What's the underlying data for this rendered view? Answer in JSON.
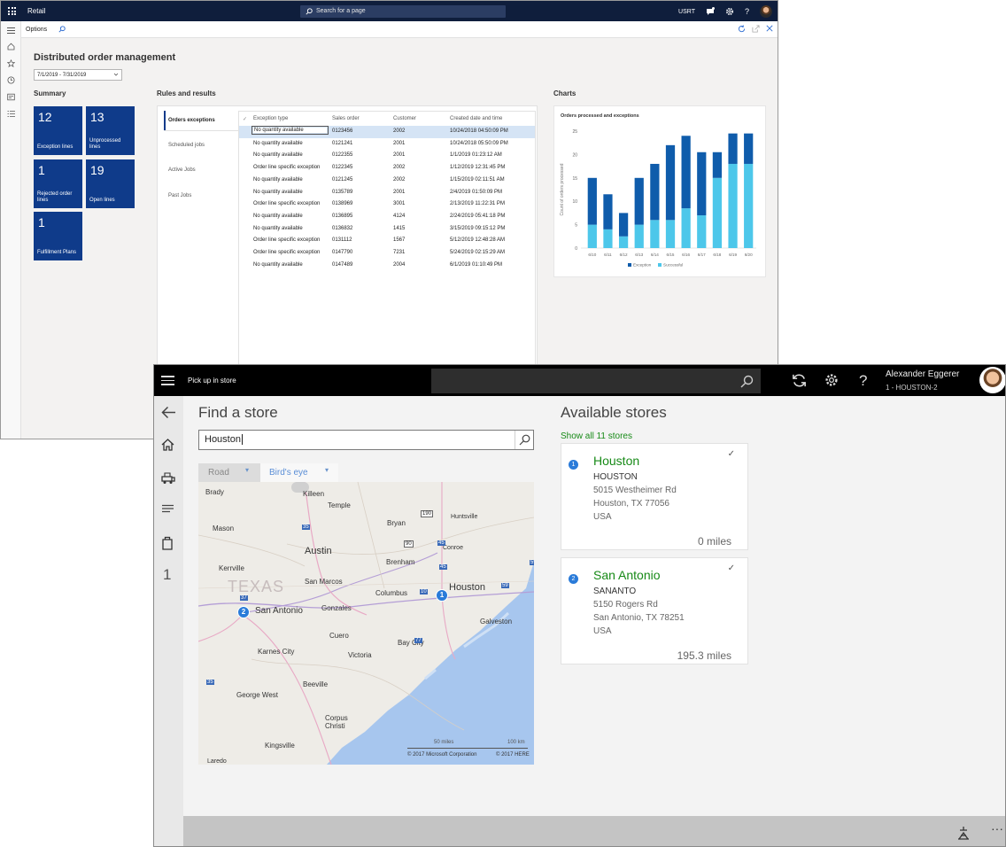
{
  "window1": {
    "app_name": "Retail",
    "search_placeholder": "Search for a page",
    "user_code": "USRT",
    "actionbar": {
      "options_label": "Options"
    },
    "page_title": "Distributed order management",
    "date_range": "7/1/2019 - 7/31/2019",
    "summary": {
      "heading": "Summary",
      "tiles": [
        {
          "value": "12",
          "label": "Exception lines"
        },
        {
          "value": "13",
          "label": "Unprocessed lines"
        },
        {
          "value": "1",
          "label": "Rejected order lines"
        },
        {
          "value": "19",
          "label": "Open lines"
        },
        {
          "value": "1",
          "label": "Fulfillment Plans"
        }
      ]
    },
    "rules": {
      "heading": "Rules and results",
      "tabs": [
        "Orders exceptions",
        "Scheduled jobs",
        "Active Jobs",
        "Past Jobs"
      ],
      "columns": [
        "Exception type",
        "Sales order",
        "Customer",
        "Created date and time"
      ],
      "rows": [
        [
          "No quantity available",
          "0123456",
          "2002",
          "10/24/2018 04:50:09 PM"
        ],
        [
          "No quantity available",
          "0121241",
          "2001",
          "10/24/2018 05:50:09 PM"
        ],
        [
          "No quantity available",
          "0122355",
          "2001",
          "1/1/2019 01:23:12 AM"
        ],
        [
          "Order line specific exception",
          "0122345",
          "2002",
          "1/12/2019 12:31:45 PM"
        ],
        [
          "No quantity available",
          "0121245",
          "2002",
          "1/15/2019 02:11:51 AM"
        ],
        [
          "No quantity available",
          "0135789",
          "2001",
          "2/4/2019 01:50:09 PM"
        ],
        [
          "Order line specific exception",
          "0138969",
          "3001",
          "2/13/2019 11:22:31 PM"
        ],
        [
          "No quantity available",
          "0136895",
          "4124",
          "2/24/2019 05:41:18 PM"
        ],
        [
          "No quantity available",
          "0136832",
          "1415",
          "3/15/2019 09:15:12 PM"
        ],
        [
          "Order line specific exception",
          "0131112",
          "1567",
          "5/12/2019 12:48:28 AM"
        ],
        [
          "Order line specific exception",
          "0147790",
          "7231",
          "5/24/2019 02:15:29 AM"
        ],
        [
          "No quantity available",
          "0147489",
          "2004",
          "6/1/2019 01:10:49 PM"
        ]
      ]
    },
    "charts": {
      "heading": "Charts"
    }
  },
  "chart_data": {
    "type": "bar",
    "stacked": true,
    "title": "Orders processed and exceptions",
    "ylabel": "Count of orders processed",
    "xlabel": "",
    "categories": [
      "6/10",
      "6/11",
      "6/12",
      "6/13",
      "6/14",
      "6/15",
      "6/16",
      "6/17",
      "6/18",
      "6/19",
      "6/20"
    ],
    "series": [
      {
        "name": "Successful",
        "color": "#4dc7ea",
        "values": [
          5,
          4,
          2.5,
          5,
          6,
          6,
          8.5,
          7,
          15,
          18,
          18
        ]
      },
      {
        "name": "Exception",
        "color": "#0f5cab",
        "values": [
          10,
          7.5,
          5,
          10,
          12,
          16,
          15.5,
          13.5,
          5.5,
          6.5,
          6.5
        ]
      }
    ],
    "ylim": [
      0,
      25
    ],
    "yticks": [
      0,
      5,
      10,
      15,
      20,
      25
    ],
    "legend": "bottom",
    "grid": false
  },
  "window2": {
    "title": "Pick up in store",
    "user_name": "Alexander Eggerer",
    "store_label": "1 - HOUSTON-2",
    "rail_number": "1",
    "find_heading": "Find a store",
    "search_value": "Houston",
    "map": {
      "road_label": "Road",
      "birdseye_label": "Bird's eye",
      "state_label": "TEXAS",
      "cities": [
        "Brady",
        "Killeen",
        "Temple",
        "Mason",
        "Bryan",
        "Huntsville",
        "Austin",
        "Brenham",
        "Conroe",
        "Kerrville",
        "San Marcos",
        "Houston",
        "Columbus",
        "San Antonio",
        "Gonzales",
        "Galveston",
        "Cuero",
        "Bay City",
        "Karnes City",
        "Victoria",
        "Beeville",
        "George West",
        "Corpus Christi",
        "Kingsville",
        "Laredo"
      ],
      "scale_small": "50 miles",
      "scale_large": "100 km",
      "copyright_left": "© 2017 Microsoft Corporation",
      "copyright_right": "© 2017 HERE",
      "pins": [
        "1",
        "2"
      ],
      "highway_shields": [
        "190",
        "45",
        "35",
        "10",
        "37",
        "59",
        "77",
        "90",
        "45",
        "35",
        "59"
      ]
    },
    "available_heading": "Available stores",
    "show_all_label": "Show all 11 stores",
    "stores": [
      {
        "pin": "1",
        "name": "Houston",
        "code": "HOUSTON",
        "address1": "5015 Westheimer Rd",
        "address2": "Houston, TX 77056",
        "country": "USA",
        "distance": "0 miles"
      },
      {
        "pin": "2",
        "name": "San Antonio",
        "code": "SANANTO",
        "address1": "5150 Rogers Rd",
        "address2": "San Antonio, TX 78251",
        "country": "USA",
        "distance": "195.3 miles"
      }
    ]
  }
}
